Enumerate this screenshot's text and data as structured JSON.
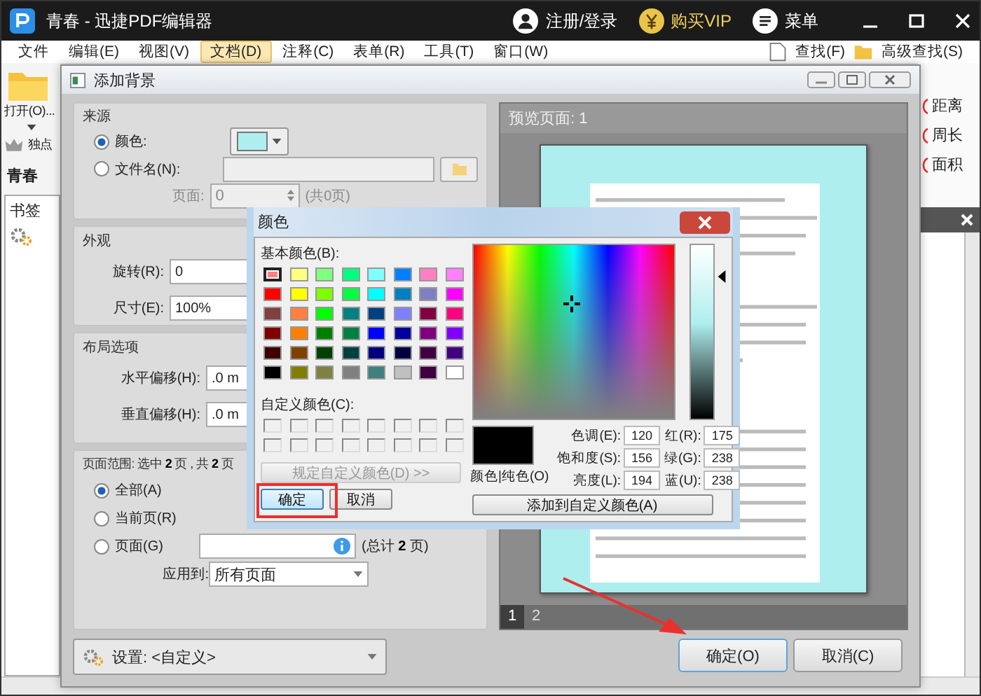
{
  "app": {
    "title": "青春 - 迅捷PDF编辑器",
    "account": "注册/登录",
    "vip": "购买VIP",
    "menu": "菜单",
    "menubar": [
      {
        "label": "文件",
        "selected": false
      },
      {
        "label": "编辑(E)",
        "selected": false
      },
      {
        "label": "视图(V)",
        "selected": false
      },
      {
        "label": "文档(D)",
        "selected": true
      },
      {
        "label": "注释(C)",
        "selected": false
      },
      {
        "label": "表单(R)",
        "selected": false
      },
      {
        "label": "工具(T)",
        "selected": false
      },
      {
        "label": "窗口(W)",
        "selected": false
      }
    ],
    "search": "查找(F)",
    "advanced_search": "高级查找(S)",
    "open": "打开(O)...",
    "exclusive": "独点",
    "doc_tab": "青春",
    "bookmarks": "书签",
    "measure_tools": [
      "距离",
      "周长",
      "面积"
    ]
  },
  "dialog": {
    "title": "添加背景",
    "source": {
      "heading": "来源",
      "options": [
        {
          "label": "颜色:",
          "selected": true
        },
        {
          "label": "文件名(N):",
          "selected": false
        }
      ],
      "swatch": {
        "color": "#afeeee"
      },
      "page_label": "页面:",
      "page_value": "0",
      "page_disabled": true,
      "page_count": "(共0页)"
    },
    "appearance": {
      "heading": "外观",
      "rotation_label": "旋转(R):",
      "rotation": "0",
      "scale_label": "尺寸(E):",
      "scale": "100%"
    },
    "layout": {
      "heading": "布局选项",
      "h_label": "水平偏移(H):",
      "h_value": ".0 m",
      "v_label": "垂直偏移(H):",
      "v_value": ".0 m"
    },
    "range": {
      "heading": "页面范围: 选中 **2** 页 , 共 **2** 页",
      "options": [
        {
          "label": "全部(A)",
          "selected": true
        },
        {
          "label": "当前页(R)",
          "selected": false
        },
        {
          "label": "页面(G)",
          "selected": false
        }
      ],
      "total": "(总计 **2** 页)",
      "apply_label": "应用到:",
      "apply_value": "所有页面"
    },
    "settings": "设置: <自定义>",
    "preview": {
      "title": "预览页面: 1",
      "pages": [
        {
          "label": "1",
          "selected": true
        },
        {
          "label": "2",
          "selected": false
        }
      ]
    },
    "buttons": [
      "确定(O)",
      "取消(C)"
    ]
  },
  "color_dialog": {
    "title": "颜色",
    "basic_label": "基本颜色(B):",
    "basic_colors": [
      {
        "color": "#ff8080",
        "selected": true
      },
      {
        "color": "#ffff80",
        "selected": false
      },
      {
        "color": "#80ff80",
        "selected": false
      },
      {
        "color": "#00ff80",
        "selected": false
      },
      {
        "color": "#80ffff",
        "selected": false
      },
      {
        "color": "#0080ff",
        "selected": false
      },
      {
        "color": "#ff80c0",
        "selected": false
      },
      {
        "color": "#ff80ff",
        "selected": false
      },
      {
        "color": "#ff0000",
        "selected": false
      },
      {
        "color": "#ffff00",
        "selected": false
      },
      {
        "color": "#80ff00",
        "selected": false
      },
      {
        "color": "#00ff40",
        "selected": false
      },
      {
        "color": "#00ffff",
        "selected": false
      },
      {
        "color": "#0080c0",
        "selected": false
      },
      {
        "color": "#8080c0",
        "selected": false
      },
      {
        "color": "#ff00ff",
        "selected": false
      },
      {
        "color": "#804040",
        "selected": false
      },
      {
        "color": "#ff8040",
        "selected": false
      },
      {
        "color": "#00ff00",
        "selected": false
      },
      {
        "color": "#008080",
        "selected": false
      },
      {
        "color": "#004080",
        "selected": false
      },
      {
        "color": "#8080ff",
        "selected": false
      },
      {
        "color": "#800040",
        "selected": false
      },
      {
        "color": "#ff0080",
        "selected": false
      },
      {
        "color": "#800000",
        "selected": false
      },
      {
        "color": "#ff8000",
        "selected": false
      },
      {
        "color": "#008000",
        "selected": false
      },
      {
        "color": "#008040",
        "selected": false
      },
      {
        "color": "#0000ff",
        "selected": false
      },
      {
        "color": "#0000a0",
        "selected": false
      },
      {
        "color": "#800080",
        "selected": false
      },
      {
        "color": "#8000ff",
        "selected": false
      },
      {
        "color": "#400000",
        "selected": false
      },
      {
        "color": "#804000",
        "selected": false
      },
      {
        "color": "#004000",
        "selected": false
      },
      {
        "color": "#004040",
        "selected": false
      },
      {
        "color": "#000080",
        "selected": false
      },
      {
        "color": "#000040",
        "selected": false
      },
      {
        "color": "#400040",
        "selected": false
      },
      {
        "color": "#400080",
        "selected": false
      },
      {
        "color": "#000000",
        "selected": false
      },
      {
        "color": "#808000",
        "selected": false
      },
      {
        "color": "#808040",
        "selected": false
      },
      {
        "color": "#808080",
        "selected": false
      },
      {
        "color": "#408080",
        "selected": false
      },
      {
        "color": "#c0c0c0",
        "selected": false
      },
      {
        "color": "#400040",
        "selected": false
      },
      {
        "color": "#ffffff",
        "selected": false
      }
    ],
    "custom_label": "自定义颜色(C):",
    "define_button": "规定自定义颜色(D) >>",
    "define_disabled": true,
    "ok": "确定",
    "cancel": "取消",
    "preview": {
      "color": "#000000"
    },
    "current_label": "颜色|纯色(O)",
    "fields": [
      {
        "label": "色调(E):",
        "value": "120"
      },
      {
        "label": "红(R):",
        "value": "175"
      },
      {
        "label": "饱和度(S):",
        "value": "156"
      },
      {
        "label": "绿(G):",
        "value": "238"
      },
      {
        "label": "亮度(L):",
        "value": "194"
      },
      {
        "label": "蓝(U):",
        "value": "238"
      }
    ],
    "add_button": "添加到自定义颜色(A)"
  }
}
